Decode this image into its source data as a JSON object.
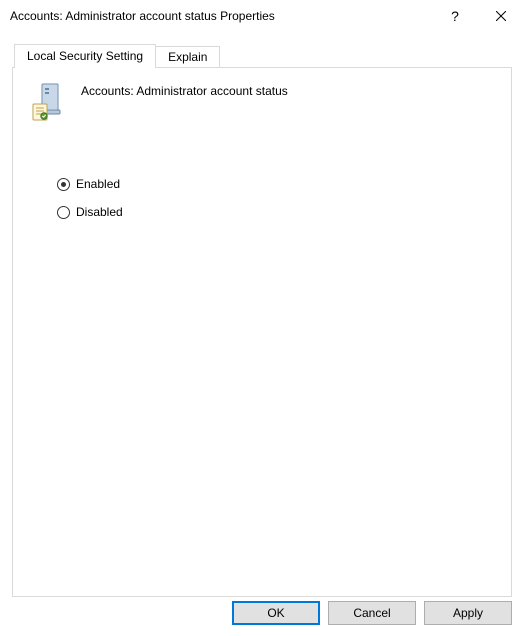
{
  "titlebar": {
    "title": "Accounts: Administrator account status Properties"
  },
  "tabs": {
    "local_security_setting": "Local Security Setting",
    "explain": "Explain"
  },
  "policy": {
    "name": "Accounts: Administrator account status"
  },
  "options": {
    "enabled": "Enabled",
    "disabled": "Disabled",
    "selected": "enabled"
  },
  "buttons": {
    "ok": "OK",
    "cancel": "Cancel",
    "apply": "Apply"
  }
}
